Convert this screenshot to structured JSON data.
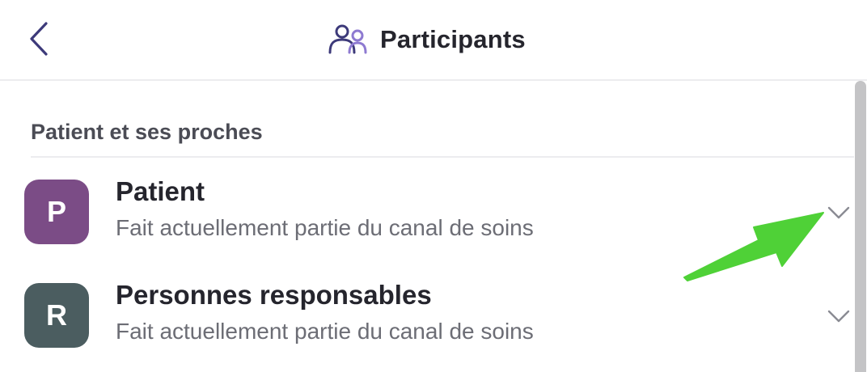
{
  "header": {
    "back_icon": "chevron-left-icon",
    "title_icon": "participants-icon",
    "title": "Participants"
  },
  "section": {
    "title": "Patient et ses proches"
  },
  "participants": [
    {
      "initial": "P",
      "title": "Patient",
      "subtitle": "Fait actuellement partie du canal de soins",
      "avatar_color": "#7b4c86",
      "expand_icon": "chevron-down-icon"
    },
    {
      "initial": "R",
      "title": "Personnes responsables",
      "subtitle": "Fait actuellement partie du canal de soins",
      "avatar_color": "#4b5d60",
      "expand_icon": "chevron-down-icon"
    }
  ],
  "colors": {
    "accent": "#3d3a7a",
    "accent_light": "#8e7ad1",
    "annotation": "#4fd137"
  }
}
